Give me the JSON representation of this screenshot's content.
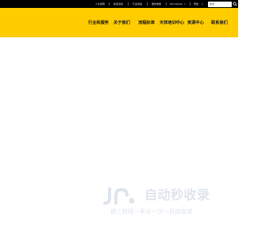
{
  "topbar": {
    "links": [
      "人才招聘",
      "新闻活动",
      "行业协会",
      "服务质量",
      "Worldwide",
      "登陆"
    ],
    "search_placeholder": "搜索"
  },
  "nav": {
    "items": [
      "行业和服务",
      "关于我们",
      "流程标准",
      "天祥培训中心",
      "资源中心",
      "联系我们"
    ]
  },
  "watermark": {
    "title": "自动秒收录",
    "slogan": "做上链接一来访一次一自动收录"
  },
  "colors": {
    "header": "#ffcc00",
    "topbar": "#000000",
    "watermark": "#dfe5ec"
  }
}
